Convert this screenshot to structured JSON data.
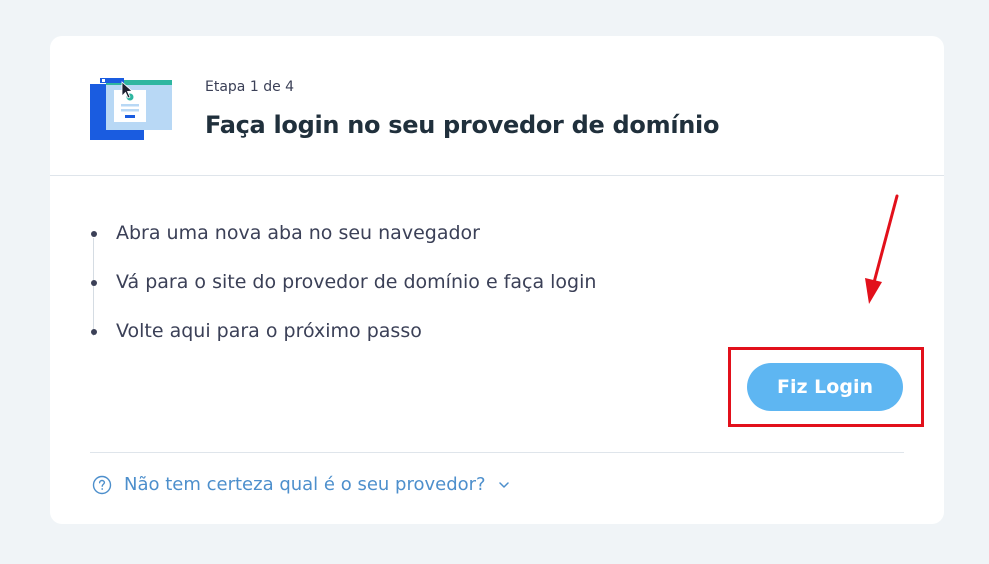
{
  "header": {
    "step_label": "Etapa 1 de 4",
    "title": "Faça login no seu provedor de domínio"
  },
  "steps": [
    {
      "text": "Abra uma nova aba no seu navegador"
    },
    {
      "text": "Vá para o site do provedor de domínio e faça login"
    },
    {
      "text": "Volte aqui para o próximo passo"
    }
  ],
  "actions": {
    "login_button_label": "Fiz Login"
  },
  "help": {
    "text": "Não tem certeza qual é o seu provedor?",
    "icon": "question-circle-icon",
    "chevron": "chevron-down-icon"
  },
  "colors": {
    "background": "#f0f4f7",
    "card": "#ffffff",
    "button": "#5eb6f2",
    "link": "#4d8fcc",
    "annotation": "#e2101b",
    "title": "#20303c",
    "text": "#3b4057"
  }
}
